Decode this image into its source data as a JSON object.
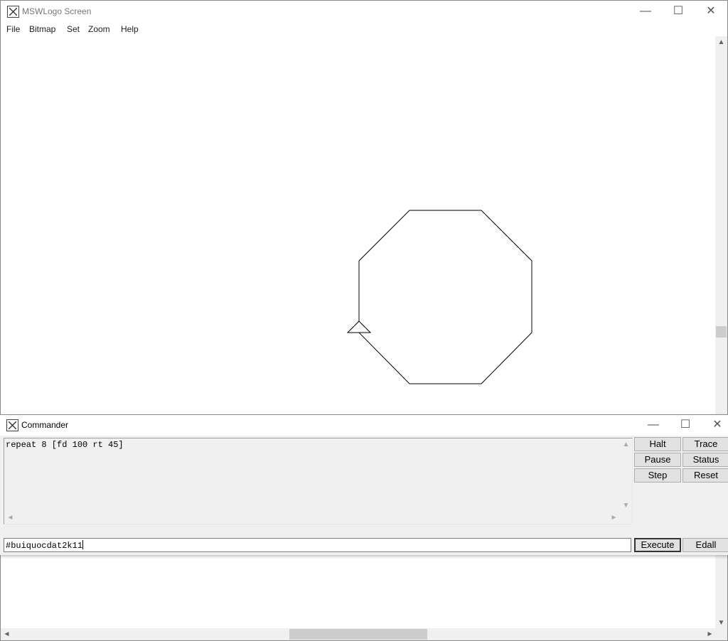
{
  "main_window": {
    "title": "MSWLogo Screen",
    "controls": {
      "minimize": "—",
      "maximize": "☐",
      "close": "✕"
    },
    "menu": [
      "File",
      "Bitmap",
      "Set",
      "Zoom",
      "Help"
    ]
  },
  "canvas": {
    "shape": "octagon",
    "command": "repeat 8 [fd 100 rt 45]",
    "turtle": "triangle-turtle-icon"
  },
  "scrollbars": {
    "up": "▲",
    "down": "▼",
    "left": "◄",
    "right": "►"
  },
  "commander": {
    "title": "Commander",
    "controls": {
      "minimize": "—",
      "maximize": "☐",
      "close": "✕"
    },
    "history": [
      "repeat 8 [fd 100 rt 45]"
    ],
    "input_value": "#buiquocdat2k11",
    "buttons": {
      "halt": "Halt",
      "trace": "Trace",
      "pause": "Pause",
      "status": "Status",
      "step": "Step",
      "reset": "Reset",
      "execute": "Execute",
      "edall": "Edall"
    }
  },
  "colors": {
    "line": "#000000",
    "window_bg": "#f0f0f0",
    "canvas_bg": "#ffffff"
  }
}
